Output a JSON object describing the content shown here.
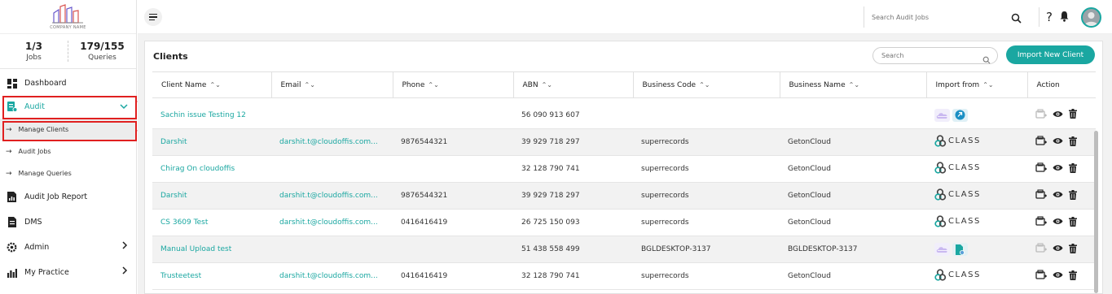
{
  "sidebar": {
    "logo_text": "COMPANY NAME",
    "stats": [
      {
        "value": "1/3",
        "label": "Jobs"
      },
      {
        "value": "179/155",
        "label": "Queries"
      }
    ],
    "items": [
      {
        "label": "Dashboard",
        "icon": "dashboard-icon"
      },
      {
        "label": "Audit",
        "icon": "audit-icon"
      },
      {
        "label": "Manage Clients"
      },
      {
        "label": "Audit Jobs"
      },
      {
        "label": "Manage Queries"
      },
      {
        "label": "Audit Job Report",
        "icon": "report-icon"
      },
      {
        "label": "DMS",
        "icon": "document-icon"
      },
      {
        "label": "Admin",
        "icon": "gear-icon"
      },
      {
        "label": "My Practice",
        "icon": "chart-icon"
      }
    ]
  },
  "topbar": {
    "search_placeholder": "Search Audit Jobs",
    "help": "?"
  },
  "clients": {
    "title": "Clients",
    "search_placeholder": "Search",
    "import_button": "Import New Client",
    "columns": [
      "Client Name",
      "Email",
      "Phone",
      "ABN",
      "Business Code",
      "Business Name",
      "Import from",
      "Action"
    ],
    "rows": [
      {
        "name": "Sachin issue Testing 12",
        "email": "",
        "phone": "",
        "abn": "56 090 913 607",
        "code": "",
        "business": "",
        "import": "cloud"
      },
      {
        "name": "Darshit",
        "email": "darshit.t@cloudoffis.com...",
        "phone": "9876544321",
        "abn": "39 929 718 297",
        "code": "superrecords",
        "business": "GetonCloud",
        "import": "class"
      },
      {
        "name": "Chirag On cloudoffis",
        "email": "",
        "phone": "",
        "abn": "32 128 790 741",
        "code": "superrecords",
        "business": "GetonCloud",
        "import": "class"
      },
      {
        "name": "Darshit",
        "email": "darshit.t@cloudoffis.com...",
        "phone": "9876544321",
        "abn": "39 929 718 297",
        "code": "superrecords",
        "business": "GetonCloud",
        "import": "class"
      },
      {
        "name": "CS 3609 Test",
        "email": "darshit.t@cloudoffis.com...",
        "phone": "0416416419",
        "abn": "26 725 150 093",
        "code": "superrecords",
        "business": "GetonCloud",
        "import": "class"
      },
      {
        "name": "Manual Upload test",
        "email": "",
        "phone": "",
        "abn": "51 438 558 499",
        "code": "BGLDESKTOP-3137",
        "business": "BGLDESKTOP-3137",
        "import": "cloud-file"
      },
      {
        "name": "Trusteetest",
        "email": "darshit.t@cloudoffis.com...",
        "phone": "0416416419",
        "abn": "32 128 790 741",
        "code": "superrecords",
        "business": "GetonCloud",
        "import": "class"
      }
    ],
    "class_logo_text": "CLASS"
  },
  "annotations": {
    "one": "1",
    "two": "2"
  },
  "colors": {
    "accent": "#1aa7a1",
    "annotation": "#e02020"
  }
}
